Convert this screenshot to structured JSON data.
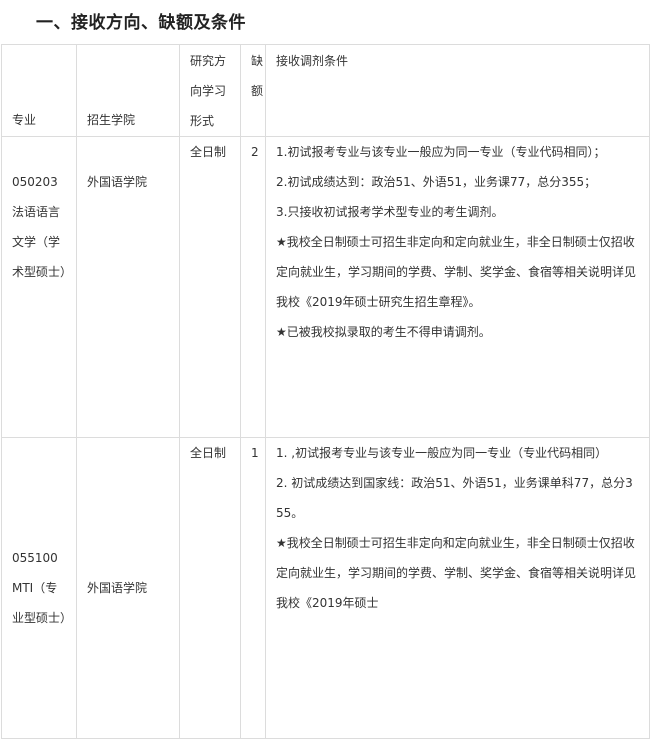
{
  "section_title": "一、接收方向、缺额及条件",
  "table": {
    "headers": {
      "major": "专业",
      "college": "招生学院",
      "study_mode": "研究方向学习形式",
      "quota": "缺额",
      "conditions": "接收调剂条件"
    },
    "rows": [
      {
        "major": "050203 法语语言文学（学术型硕士）",
        "college": "外国语学院",
        "study_mode": "全日制",
        "quota": "2",
        "conditions": [
          "1.初试报考专业与该专业一般应为同一专业（专业代码相同）；",
          "2.初试成绩达到：政治51、外语51，业务课77，总分355；",
          "3.只接收初试报考学术型专业的考生调剂。",
          "★我校全日制硕士可招生非定向和定向就业生，非全日制硕士仅招收定向就业生，学习期间的学费、学制、奖学金、食宿等相关说明详见我校《2019年硕士研究生招生章程》。",
          "★已被我校拟录取的考生不得申请调剂。"
        ]
      },
      {
        "major": "055100 MTI（专业型硕士）",
        "college": "外国语学院",
        "study_mode": "全日制",
        "quota": "1",
        "conditions": [
          "1. ,初试报考专业与该专业一般应为同一专业（专业代码相同）",
          "2. 初试成绩达到国家线：政治51、外语51，业务课单科77，总分355。",
          "★我校全日制硕士可招生非定向和定向就业生，非全日制硕士仅招收定向就业生，学习期间的学费、学制、奖学金、食宿等相关说明详见我校《2019年硕士"
        ]
      }
    ]
  }
}
